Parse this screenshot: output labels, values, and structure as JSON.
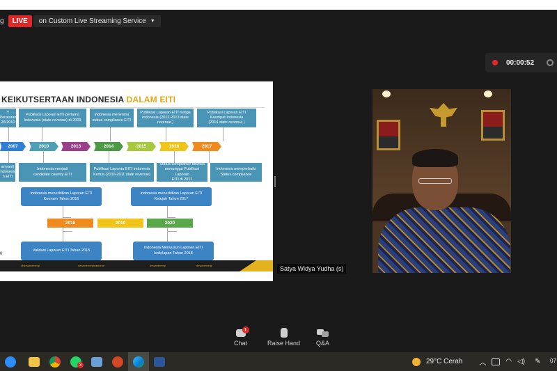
{
  "window": {
    "cut_label": "g",
    "live_badge": "LIVE",
    "live_service": "on Custom Live Streaming Service",
    "recording_time": "00:00:52"
  },
  "slide": {
    "title_dark": "KEIKUTSERTAAN INDONESIA ",
    "title_gold": "DALAM EITI",
    "top_boxes": [
      "Y\nPeraturan\n26/2010",
      "Publikasi Laporan EITI pertama\nIndonesia (state revenue) di 2009",
      "Indonesia menerima\nstatus compliance EITI",
      "Publikasi Laporan EITI Ketiga\nIndonesia (2012-2013 state\nrevenue )",
      "Publikasi Laporan EITI\nKeempat Indonesia\n(2014 state revenue )"
    ],
    "years": [
      "2007",
      "2010",
      "2013",
      "2014",
      "2015",
      "2016",
      "2017"
    ],
    "bottom_boxes": [
      "arryani)\nIndonesia\nn EITI",
      "Indonesia menjadi\ncandidate country EITI",
      "Publikasi Laporan EITI Indonesia\nKedua (2010-2011 state revenue)",
      "Status compliance ditunda\nmenunggu Publikasi Laporan\nEITI di 2012",
      "Indonesia memperbaiki\nStatus compliance"
    ],
    "mid_left": "Indonesia menerbitkan Laporan EITI\nKeenam Tahun 2016",
    "mid_right": "Indonesia menerbitkan Laporan EITI\nKetujuh Tahun 2017",
    "years2": [
      "2018",
      "2019",
      "2020"
    ],
    "low_left": "Validasi Laporan EITI Tahun 2015",
    "low_right": "Indonesia Menyusun Laporan EITI\nkedelapan Tahun 2018",
    "zero": "0",
    "footer": [
      "@dewanenergi",
      "dewanenerginasional",
      "dewanenergi",
      "dewanenergi"
    ]
  },
  "participant": {
    "name": "Satya Widya Yudha (s)"
  },
  "controls": {
    "chat_label": "Chat",
    "chat_badge": "1",
    "raise_hand_label": "Raise Hand",
    "qa_label": "Q&A"
  },
  "taskbar": {
    "whatsapp_badge": "3",
    "weather": "29°C  Cerah",
    "clock": "07"
  },
  "colors": {
    "live": "#e02828",
    "slide_teal": "#4a95b6",
    "slide_blue": "#3d84c4",
    "title_gold": "#e3a812"
  }
}
